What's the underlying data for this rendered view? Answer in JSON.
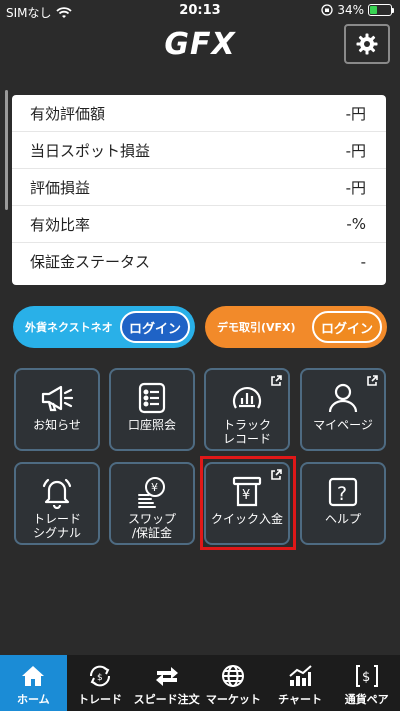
{
  "status": {
    "carrier": "SIMなし",
    "time": "20:13",
    "battery": "34%"
  },
  "header": {
    "logo": "GFX"
  },
  "summary": [
    {
      "label": "有効評価額",
      "value": "-円"
    },
    {
      "label": "当日スポット損益",
      "value": "-円"
    },
    {
      "label": "評価損益",
      "value": "-円"
    },
    {
      "label": "有効比率",
      "value": "-%"
    },
    {
      "label": "保証金ステータス",
      "value": "-"
    }
  ],
  "login": {
    "left": {
      "label": "外貨ネクストネオ",
      "button": "ログイン"
    },
    "right": {
      "label": "デモ取引(VFX)",
      "button": "ログイン"
    }
  },
  "tiles": [
    {
      "label": "お知らせ",
      "icon": "megaphone-icon"
    },
    {
      "label": "口座照会",
      "icon": "list-icon"
    },
    {
      "label": "トラック\nレコード",
      "icon": "track-record-icon"
    },
    {
      "label": "マイページ",
      "icon": "person-icon"
    },
    {
      "label": "トレード\nシグナル",
      "icon": "bell-icon"
    },
    {
      "label": "スワップ\n/保証金",
      "icon": "coins-icon"
    },
    {
      "label": "クイック入金",
      "icon": "atm-icon"
    },
    {
      "label": "ヘルプ",
      "icon": "help-icon"
    }
  ],
  "nav": [
    {
      "label": "ホーム",
      "icon": "home-icon"
    },
    {
      "label": "トレード",
      "icon": "trade-icon"
    },
    {
      "label": "スピード注文",
      "icon": "speed-order-icon"
    },
    {
      "label": "マーケット",
      "icon": "globe-icon"
    },
    {
      "label": "チャート",
      "icon": "chart-icon"
    },
    {
      "label": "通貨ペア",
      "icon": "currency-pair-icon"
    }
  ],
  "colors": {
    "accent": "#1b8cd6",
    "login_blue": "#29b0e8",
    "login_orange": "#f28a2a",
    "highlight": "#e01818"
  }
}
